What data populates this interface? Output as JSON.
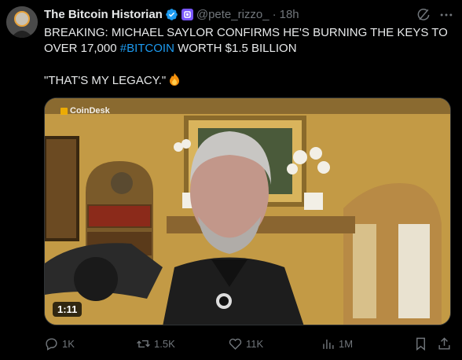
{
  "author": {
    "name": "The Bitcoin Historian",
    "handle": "@pete_rizzo_",
    "separator": "·",
    "time": "18h"
  },
  "tweet": {
    "line1": "BREAKING: MICHAEL SAYLOR CONFIRMS HE'S BURNING THE KEYS TO",
    "line2_pre": "OVER 17,000 ",
    "hashtag": "#BITCOIN",
    "line2_post": " WORTH $1.5 BILLION",
    "quote": "\"THAT'S MY LEGACY.\""
  },
  "media": {
    "watermark": "CoinDesk",
    "duration": "1:11"
  },
  "actions": {
    "replies": "1K",
    "reposts": "1.5K",
    "likes": "11K",
    "views": "1M"
  },
  "colors": {
    "accent": "#1d9bf0",
    "muted": "#71767b",
    "text": "#e7e9ea",
    "background": "#000000"
  },
  "icons": [
    "verified-icon",
    "subscriber-badge-icon",
    "grok-icon",
    "more-icon",
    "fire-icon",
    "reply-icon",
    "repost-icon",
    "like-icon",
    "views-icon",
    "bookmark-icon",
    "share-icon"
  ]
}
